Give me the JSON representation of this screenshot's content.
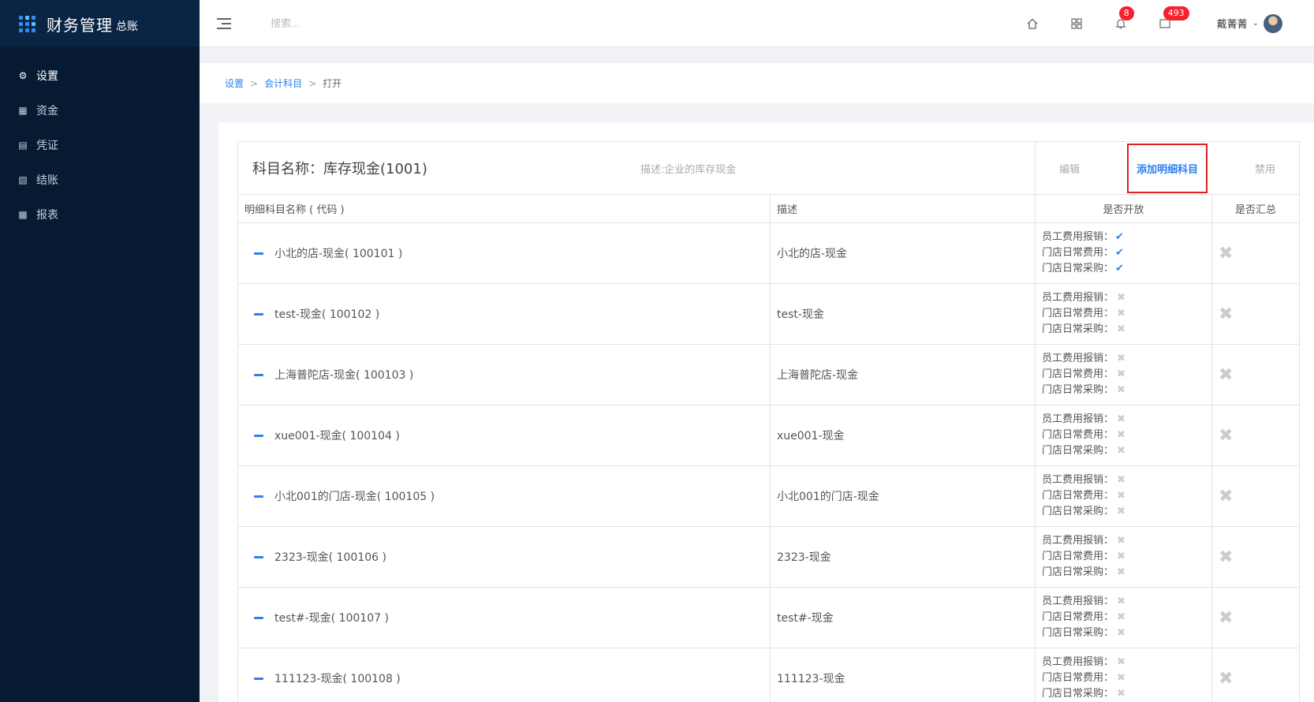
{
  "app": {
    "title": "财务管理",
    "subtitle": "总账"
  },
  "sidebar": {
    "items": [
      {
        "label": "设置",
        "icon": "gear-icon",
        "active": true
      },
      {
        "label": "资金",
        "icon": "funds-icon",
        "active": false
      },
      {
        "label": "凭证",
        "icon": "voucher-icon",
        "active": false
      },
      {
        "label": "结账",
        "icon": "checkout-icon",
        "active": false
      },
      {
        "label": "报表",
        "icon": "chart-icon",
        "active": false
      }
    ]
  },
  "header": {
    "search_placeholder": "搜索...",
    "notifications_count": "8",
    "messages_count": "493",
    "user_name": "戴菁菁"
  },
  "breadcrumb": {
    "level1": "设置",
    "level2": "会计科目",
    "current": "打开"
  },
  "panel": {
    "subject": "科目名称：库存现金(1001)",
    "description": "描述:企业的库存现金",
    "edit_label": "编辑",
    "add_label": "添加明细科目",
    "disable_label": "禁用"
  },
  "columns": {
    "name": "明细科目名称 ( 代码 )",
    "desc": "描述",
    "open": "是否开放",
    "summary": "是否汇总"
  },
  "flag_labels": [
    "员工费用报销：",
    "门店日常费用：",
    "门店日常采购："
  ],
  "rows": [
    {
      "name": "小北的店-现金( 100101 )",
      "desc": "小北的店-现金",
      "flags": [
        true,
        true,
        true
      ]
    },
    {
      "name": "test-现金( 100102 )",
      "desc": "test-现金",
      "flags": [
        false,
        false,
        false
      ]
    },
    {
      "name": "上海普陀店-现金( 100103 )",
      "desc": "上海普陀店-现金",
      "flags": [
        false,
        false,
        false
      ]
    },
    {
      "name": "xue001-现金( 100104 )",
      "desc": "xue001-现金",
      "flags": [
        false,
        false,
        false
      ]
    },
    {
      "name": "小北001的门店-现金( 100105 )",
      "desc": "小北001的门店-现金",
      "flags": [
        false,
        false,
        false
      ]
    },
    {
      "name": "2323-现金( 100106 )",
      "desc": "2323-现金",
      "flags": [
        false,
        false,
        false
      ]
    },
    {
      "name": "test#-现金( 100107 )",
      "desc": "test#-现金",
      "flags": [
        false,
        false,
        false
      ]
    },
    {
      "name": "111123-现金( 100108 )",
      "desc": "111123-现金",
      "flags": [
        false,
        false,
        false
      ]
    }
  ]
}
